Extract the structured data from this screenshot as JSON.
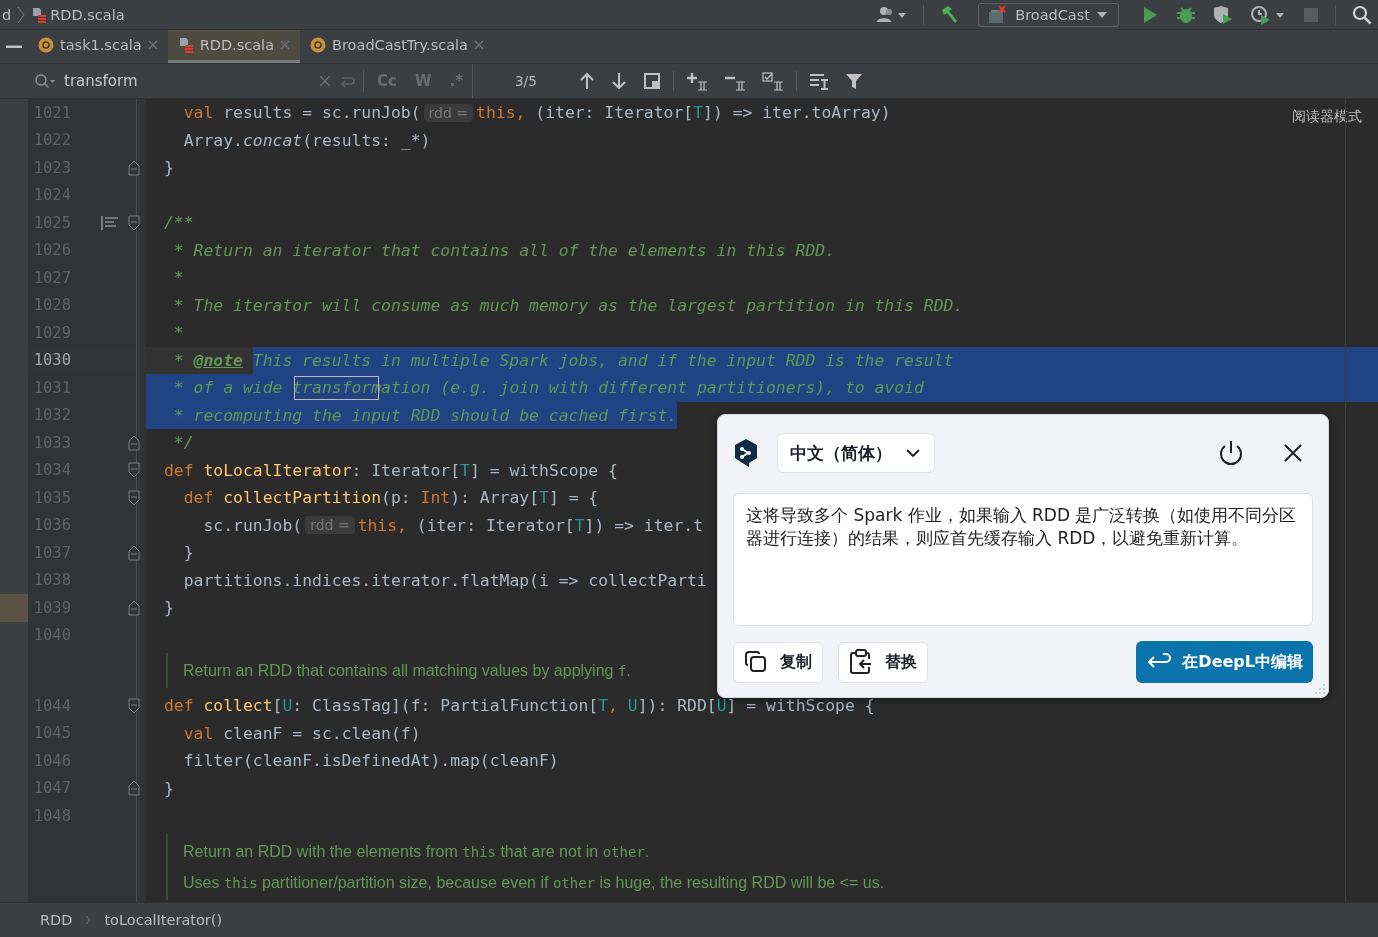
{
  "nav_bar": {
    "crumbs": [
      {
        "label": "d",
        "icon": false
      },
      {
        "label": "RDD.scala",
        "icon": true
      }
    ],
    "run_config": "BroadCast"
  },
  "tabs": [
    {
      "label": "task1.scala",
      "kind": "object",
      "selected": false
    },
    {
      "label": "RDD.scala",
      "kind": "class",
      "selected": true
    },
    {
      "label": "BroadCastTry.scala",
      "kind": "object",
      "selected": false
    }
  ],
  "find_bar": {
    "value": "transform",
    "options": [
      "Cc",
      "W",
      ".*"
    ],
    "match_count": "3/5"
  },
  "reader_mode": "阅读器模式",
  "rows": [
    {
      "kind": "code",
      "num": "1021",
      "tokens": [
        {
          "t": "  val ",
          "kind": "kw"
        },
        {
          "t": "results = sc.runJob(",
          "kind": "plain"
        },
        {
          "t": "rdd =",
          "kind": "hint"
        },
        {
          "t": "this, ",
          "kind": "kw"
        },
        {
          "t": "(iter: Iterator[",
          "kind": "plain"
        },
        {
          "t": "T",
          "kind": "type"
        },
        {
          "t": "]) => iter.toArray)",
          "kind": "plain"
        }
      ]
    },
    {
      "kind": "code",
      "num": "1022",
      "tokens": [
        {
          "t": "  Array.",
          "kind": "plain"
        },
        {
          "t": "concat",
          "kind": "italic"
        },
        {
          "t": "(results: _*)",
          "kind": "plain"
        }
      ]
    },
    {
      "kind": "code",
      "num": "1023",
      "fold_end": true,
      "tokens": [
        {
          "t": "}",
          "kind": "plain"
        }
      ]
    },
    {
      "kind": "code",
      "num": "1024",
      "tokens": []
    },
    {
      "kind": "code",
      "num": "1025",
      "fold_start": true,
      "doc_toggle": true,
      "tokens": [
        {
          "t": "/**",
          "kind": "comment"
        }
      ]
    },
    {
      "kind": "code",
      "num": "1026",
      "tokens": [
        {
          "t": " * Return an iterator that contains all of the elements in this RDD.",
          "kind": "comment"
        }
      ]
    },
    {
      "kind": "code",
      "num": "1027",
      "tokens": [
        {
          "t": " *",
          "kind": "comment"
        }
      ]
    },
    {
      "kind": "code",
      "num": "1028",
      "tokens": [
        {
          "t": " * The iterator will consume as much memory as the largest partition in this RDD.",
          "kind": "comment"
        }
      ]
    },
    {
      "kind": "code",
      "num": "1029",
      "tokens": [
        {
          "t": " *",
          "kind": "comment"
        }
      ]
    },
    {
      "kind": "code",
      "num": "1030",
      "current": true,
      "sel_head": false,
      "sel_tail": true,
      "tokens": [
        {
          "t": " * ",
          "kind": "comment",
          "selected": false
        },
        {
          "t": "@note",
          "kind": "tag",
          "selected": false
        },
        {
          "t": "This results in multiple Spark jobs, and if the input RDD is the result",
          "kind": "comment",
          "selected": true
        }
      ]
    },
    {
      "kind": "code",
      "num": "1031",
      "sel_head": true,
      "sel_tail": true,
      "tokens": [
        {
          "t": " * of a wide ",
          "kind": "comment",
          "selected": true
        },
        {
          "t": "transform",
          "kind": "match",
          "selected": true
        },
        {
          "t": "ation (e.g. join with different partitioners), to avoid",
          "kind": "comment",
          "selected": true
        }
      ]
    },
    {
      "kind": "code",
      "num": "1032",
      "sel_head": true,
      "sel_tail": false,
      "tokens": [
        {
          "t": " * recomputing the input RDD should be cached first.",
          "kind": "comment",
          "selected": true
        }
      ]
    },
    {
      "kind": "code",
      "num": "1033",
      "fold_end": true,
      "tokens": [
        {
          "t": " */",
          "kind": "comment"
        }
      ]
    },
    {
      "kind": "code",
      "num": "1034",
      "fold_start": true,
      "tokens": [
        {
          "t": "def ",
          "kind": "kw"
        },
        {
          "t": "toLocalIterator",
          "kind": "fn"
        },
        {
          "t": ": Iterator[",
          "kind": "plain"
        },
        {
          "t": "T",
          "kind": "type"
        },
        {
          "t": "] = withScope {",
          "kind": "plain"
        }
      ]
    },
    {
      "kind": "code",
      "num": "1035",
      "fold_start": true,
      "tokens": [
        {
          "t": "  def ",
          "kind": "kw"
        },
        {
          "t": "collectPartition",
          "kind": "fn"
        },
        {
          "t": "(p: ",
          "kind": "plain"
        },
        {
          "t": "Int",
          "kind": "kw"
        },
        {
          "t": "): Array[",
          "kind": "plain"
        },
        {
          "t": "T",
          "kind": "type"
        },
        {
          "t": "] = {",
          "kind": "plain"
        }
      ]
    },
    {
      "kind": "code",
      "num": "1036",
      "tokens": [
        {
          "t": "    sc.runJob(",
          "kind": "plain"
        },
        {
          "t": "rdd =",
          "kind": "hint"
        },
        {
          "t": "this, ",
          "kind": "kw"
        },
        {
          "t": "(iter: Iterator[",
          "kind": "plain"
        },
        {
          "t": "T",
          "kind": "type"
        },
        {
          "t": "]) => iter.t",
          "kind": "plain"
        }
      ]
    },
    {
      "kind": "code",
      "num": "1037",
      "fold_end": true,
      "tokens": [
        {
          "t": "  }",
          "kind": "plain"
        }
      ]
    },
    {
      "kind": "code",
      "num": "1038",
      "tokens": [
        {
          "t": "  partitions.indices.iterator.flatMap(i => collectParti",
          "kind": "plain"
        }
      ]
    },
    {
      "kind": "code",
      "num": "1039",
      "fold_end": true,
      "marked": true,
      "tokens": [
        {
          "t": "}",
          "kind": "plain"
        }
      ]
    },
    {
      "kind": "code",
      "num": "1040",
      "tokens": []
    },
    {
      "kind": "doc",
      "paragraphs": [
        [
          {
            "t": "Return an RDD that contains all matching values by applying ",
            "code": false
          },
          {
            "t": "f",
            "code": true
          },
          {
            "t": ".",
            "code": false
          }
        ]
      ]
    },
    {
      "kind": "code",
      "num": "1044",
      "fold_start": true,
      "tokens": [
        {
          "t": "def ",
          "kind": "kw"
        },
        {
          "t": "collect",
          "kind": "fn"
        },
        {
          "t": "[",
          "kind": "plain"
        },
        {
          "t": "U",
          "kind": "type"
        },
        {
          "t": ": ClassTag](f: PartialFunction[",
          "kind": "plain"
        },
        {
          "t": "T",
          "kind": "type"
        },
        {
          "t": ", ",
          "kind": "kw"
        },
        {
          "t": "U",
          "kind": "type"
        },
        {
          "t": "]): RDD[",
          "kind": "plain"
        },
        {
          "t": "U",
          "kind": "type"
        },
        {
          "t": "] = withScope {",
          "kind": "plain"
        }
      ]
    },
    {
      "kind": "code",
      "num": "1045",
      "tokens": [
        {
          "t": "  val ",
          "kind": "kw"
        },
        {
          "t": "cleanF = sc.clean(f)",
          "kind": "plain"
        }
      ]
    },
    {
      "kind": "code",
      "num": "1046",
      "tokens": [
        {
          "t": "  filter(cleanF.isDefinedAt).map(cleanF)",
          "kind": "plain"
        }
      ]
    },
    {
      "kind": "code",
      "num": "1047",
      "fold_end": true,
      "tokens": [
        {
          "t": "}",
          "kind": "plain"
        }
      ]
    },
    {
      "kind": "code",
      "num": "1048",
      "tokens": []
    },
    {
      "kind": "doc",
      "paragraphs": [
        [
          {
            "t": "Return an RDD with the elements from ",
            "code": false
          },
          {
            "t": "this",
            "code": true
          },
          {
            "t": " that are not in ",
            "code": false
          },
          {
            "t": "other",
            "code": true
          },
          {
            "t": ".",
            "code": false
          }
        ],
        [
          {
            "t": "Uses ",
            "code": false
          },
          {
            "t": "this",
            "code": true
          },
          {
            "t": " partitioner/partition size, because even if ",
            "code": false
          },
          {
            "t": "other",
            "code": true
          },
          {
            "t": " is huge, the resulting RDD will be <= us.",
            "code": false
          }
        ]
      ]
    }
  ],
  "breadcrumb": [
    "RDD",
    "toLocalIterator()"
  ],
  "popup": {
    "language": "中文（简体）",
    "translation": "这将导致多个 Spark 作业，如果输入 RDD 是广泛转换（如使用不同分区器进行连接）的结果，则应首先缓存输入 RDD，以避免重新计算。",
    "buttons": [
      {
        "label": "复制",
        "kind": "copy"
      },
      {
        "label": "替换",
        "kind": "replace"
      }
    ],
    "primary_button": "在DeepL中编辑"
  }
}
